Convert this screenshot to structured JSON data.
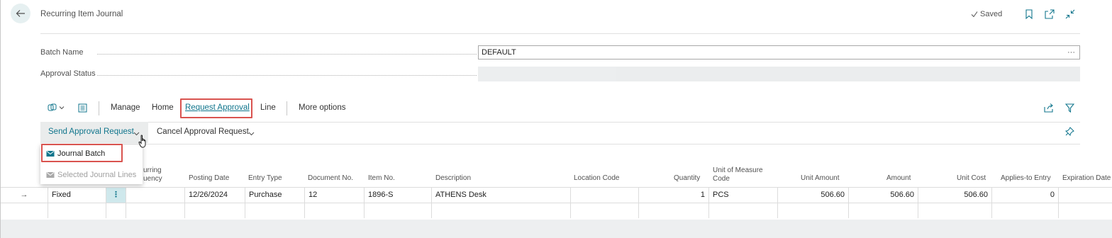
{
  "header": {
    "title": "Recurring Item Journal",
    "saved_label": "Saved"
  },
  "fields": {
    "batch_name_label": "Batch Name",
    "batch_name_value": "DEFAULT",
    "batch_name_ellipsis": "···",
    "approval_status_label": "Approval Status",
    "approval_status_value": ""
  },
  "toolbar": {
    "manage": "Manage",
    "home": "Home",
    "request_approval": "Request Approval",
    "line": "Line",
    "more_options": "More options"
  },
  "subtoolbar": {
    "send_approval_request": "Send Approval Request",
    "cancel_approval_request": "Cancel Approval Request"
  },
  "dropdown": {
    "journal_batch": "Journal Batch",
    "selected_journal_lines": "Selected Journal Lines"
  },
  "columns": {
    "recurring_frequency_a": "urring",
    "recurring_frequency_b": "uency",
    "posting_date": "Posting Date",
    "entry_type": "Entry Type",
    "document_no": "Document No.",
    "item_no": "Item No.",
    "description": "Description",
    "location_code": "Location Code",
    "quantity": "Quantity",
    "uom_a": "Unit of Measure",
    "uom_b": "Code",
    "unit_amount": "Unit Amount",
    "amount": "Amount",
    "unit_cost": "Unit Cost",
    "applies_to_entry": "Applies-to Entry",
    "expiration_date": "Expiration Date"
  },
  "rows": [
    {
      "arrow": "→",
      "recurring_method": "Fixed",
      "menu": "⋮",
      "posting_date": "12/26/2024",
      "entry_type": "Purchase",
      "document_no": "12",
      "item_no": "1896-S",
      "description": "ATHENS Desk",
      "location_code": "",
      "quantity": "1",
      "uom": "PCS",
      "unit_amount": "506.60",
      "amount": "506.60",
      "unit_cost": "506.60",
      "applies_to_entry": "0"
    }
  ],
  "colors": {
    "accent": "#10758c",
    "highlight": "#d9534f",
    "selected_cell": "#cfe8ec"
  }
}
